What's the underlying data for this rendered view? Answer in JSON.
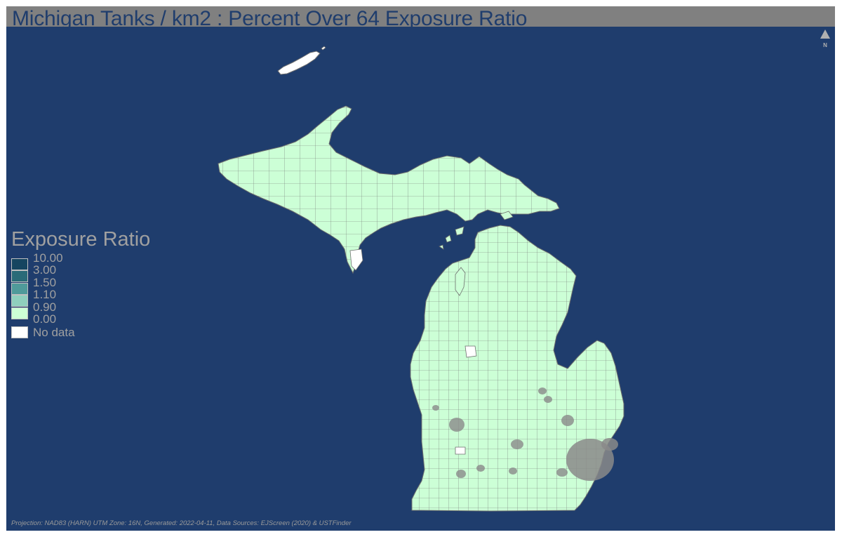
{
  "map": {
    "title": "Michigan Tanks / km2 : Percent Over 64 Exposure Ratio",
    "north_label": "N",
    "footer": "Projection: NAD83 (HARN) UTM Zone: 16N, Generated: 2022-04-11, Data Sources: EJScreen (2020) & USTFinder",
    "colors": {
      "water": "#1f3d6d",
      "land": "#ccffd6",
      "boundary": "#6f6f6f",
      "no_data": "#ffffff",
      "title_bar": "#808080"
    }
  },
  "legend": {
    "title": "Exposure Ratio",
    "breaks": [
      {
        "label": "10.00",
        "color": "#154560"
      },
      {
        "label": "3.00",
        "color": "#2a6b78"
      },
      {
        "label": "1.50",
        "color": "#4f9a9a"
      },
      {
        "label": "1.10",
        "color": "#8fcfbd"
      },
      {
        "label": "0.90",
        "color": "#ccffd6"
      },
      {
        "label": "0.00",
        "color": null
      }
    ],
    "no_data_label": "No data",
    "no_data_color": "#ffffff"
  }
}
